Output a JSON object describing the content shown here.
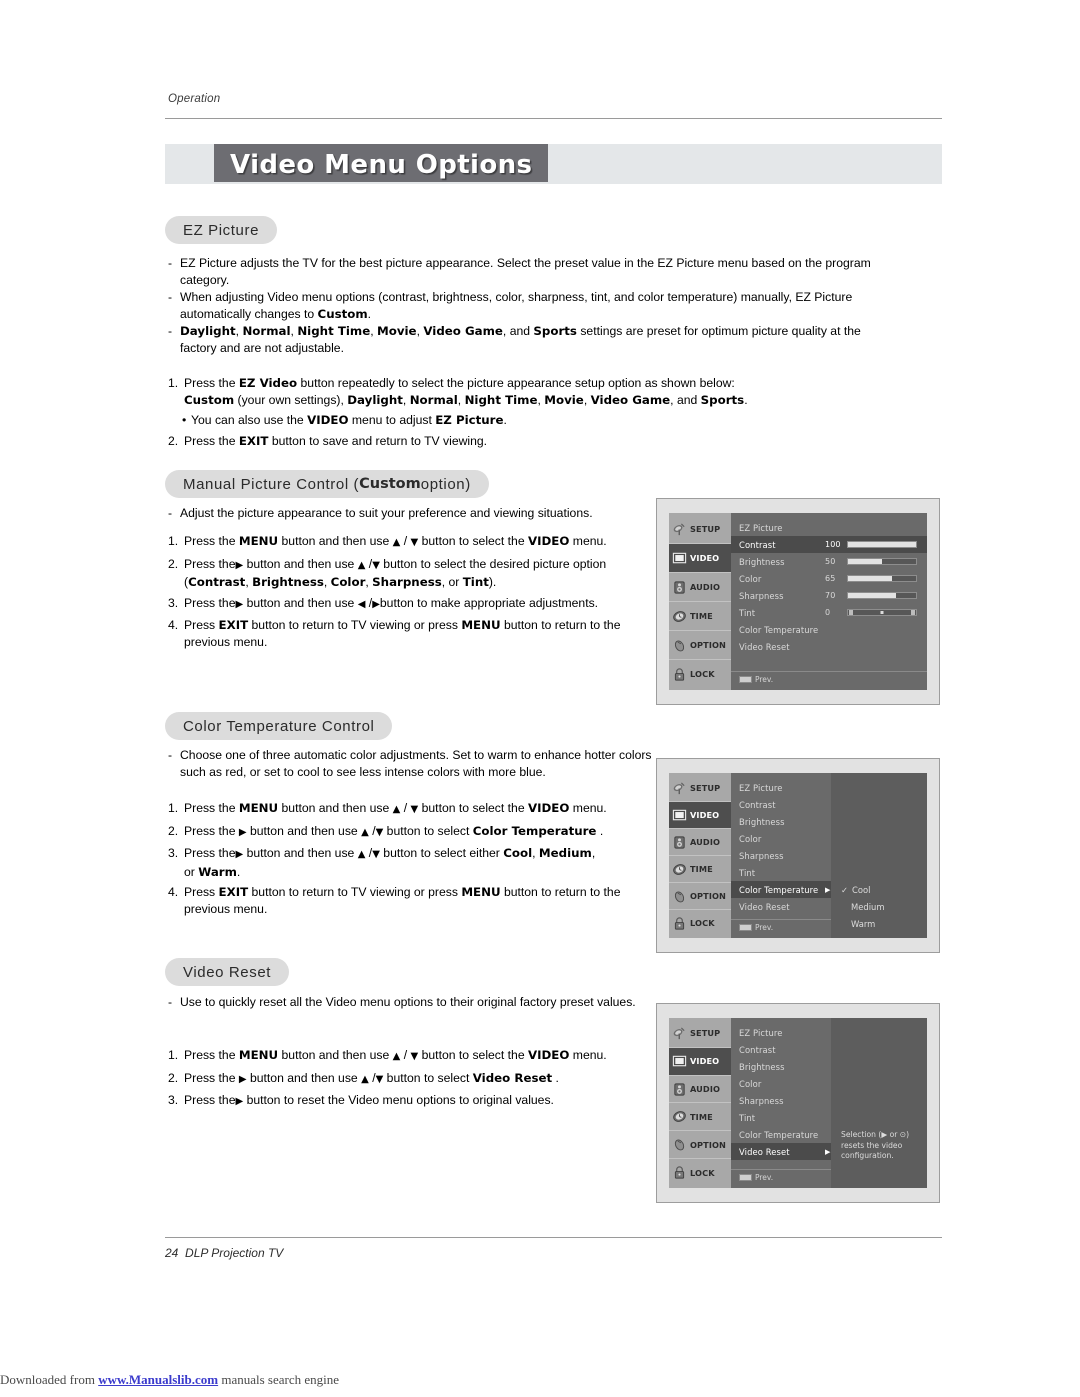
{
  "header": {
    "section_label": "Operation",
    "title": "Video Menu Options"
  },
  "sections": {
    "ez_picture": {
      "chip": "EZ Picture",
      "bullets": [
        "EZ Picture adjusts the TV for the best picture appearance. Select the preset value in the EZ Picture menu based on the program category.",
        "When adjusting Video menu options (contrast, brightness, color, sharpness, tint, and color temperature) manually, EZ Picture automatically changes to Custom.",
        "Daylight, Normal, Night Time, Movie, Video Game, and Sports settings are preset for optimum picture quality at the factory and are not adjustable."
      ],
      "step1_a": "Press the EZ Video button repeatedly to select the picture appearance setup option as shown below:",
      "step1_b": "Custom (your own settings), Daylight, Normal, Night Time, Movie, Video Game, and Sports.",
      "step1_note": "You can also use the VIDEO menu to adjust EZ Picture.",
      "step2": "Press the EXIT button to save and return to TV viewing."
    },
    "manual_picture": {
      "chip_pre": "Manual Picture Control (",
      "chip_bold": "Custom",
      "chip_post": " option)",
      "bullet": "Adjust the picture appearance to suit your preference and viewing situations.",
      "steps": [
        "Press the MENU button and then use ▲ / ▼ button to select the VIDEO menu.",
        "Press the ▶ button and then use ▲ / ▼ button to select the desired picture option (Contrast, Brightness, Color, Sharpness, or Tint).",
        "Press the ▶ button and then use ◀ / ▶ button to make appropriate adjustments.",
        "Press EXIT button to return to TV viewing or press MENU button to return to the previous menu."
      ]
    },
    "color_temperature": {
      "chip": "Color Temperature Control",
      "bullet": "Choose one of three automatic color adjustments. Set to warm to enhance hotter colors such as red, or set to cool to see less intense colors with more blue.",
      "steps": [
        "Press the MENU button and then use ▲ / ▼ button to select the VIDEO menu.",
        "Press the ▶ button and then use ▲ / ▼ button to select Color Temperature .",
        "Press the ▶ button and then use ▲ / ▼ button to select either Cool, Medium, or Warm.",
        "Press EXIT button to return to TV viewing or press MENU button to return to the previous menu."
      ]
    },
    "video_reset": {
      "chip": "Video Reset",
      "bullet": "Use to quickly reset all the Video menu options to their original factory preset values.",
      "steps": [
        "Press the MENU button and then use ▲ / ▼ button to select the VIDEO menu.",
        "Press the ▶ button and then use ▲ / ▼ button to select Video Reset .",
        "Press the ▶ button to reset the Video menu options to original values."
      ]
    }
  },
  "osd": {
    "sidebar": [
      {
        "label": "SETUP",
        "icon": "satellite-dish-icon"
      },
      {
        "label": "VIDEO",
        "icon": "screen-icon"
      },
      {
        "label": "AUDIO",
        "icon": "speaker-icon"
      },
      {
        "label": "TIME",
        "icon": "clock-icon"
      },
      {
        "label": "OPTION",
        "icon": "mouse-icon"
      },
      {
        "label": "LOCK",
        "icon": "padlock-icon"
      }
    ],
    "selected_sidebar": "VIDEO",
    "prev_label": "Prev.",
    "menu_items": [
      "EZ Picture",
      "Contrast",
      "Brightness",
      "Color",
      "Sharpness",
      "Tint",
      "Color Temperature",
      "Video Reset"
    ],
    "screen1": {
      "selected": "Contrast",
      "rows": [
        {
          "label": "EZ Picture",
          "value": "",
          "fill": null
        },
        {
          "label": "Contrast",
          "value": "100",
          "fill": 100
        },
        {
          "label": "Brightness",
          "value": "50",
          "fill": 50
        },
        {
          "label": "Color",
          "value": "65",
          "fill": 65
        },
        {
          "label": "Sharpness",
          "value": "70",
          "fill": 70
        },
        {
          "label": "Tint",
          "value": "0",
          "fill": 0
        },
        {
          "label": "Color Temperature",
          "value": "",
          "fill": null
        },
        {
          "label": "Video Reset",
          "value": "",
          "fill": null
        }
      ]
    },
    "screen2": {
      "selected": "Color Temperature",
      "submenu_options": [
        {
          "label": "Cool",
          "checked": true
        },
        {
          "label": "Medium",
          "checked": false
        },
        {
          "label": "Warm",
          "checked": false
        }
      ]
    },
    "screen3": {
      "selected": "Video Reset",
      "hint": "Selection (▶ or ⊙) resets the video configuration."
    }
  },
  "footer": {
    "page_number": "24",
    "model": "DLP Projection TV",
    "download_prefix": "Downloaded from ",
    "download_link": "www.Manualslib.com",
    "download_suffix": " manuals search engine"
  },
  "colors": {
    "title_box": "#6d6d72",
    "title_band": "#e4e7e9",
    "chip_bg": "#dcdcdc",
    "osd_bg": "#6a6a6a",
    "osd_sidebar": "#a8a8a8",
    "link": "#3b3bcc"
  }
}
